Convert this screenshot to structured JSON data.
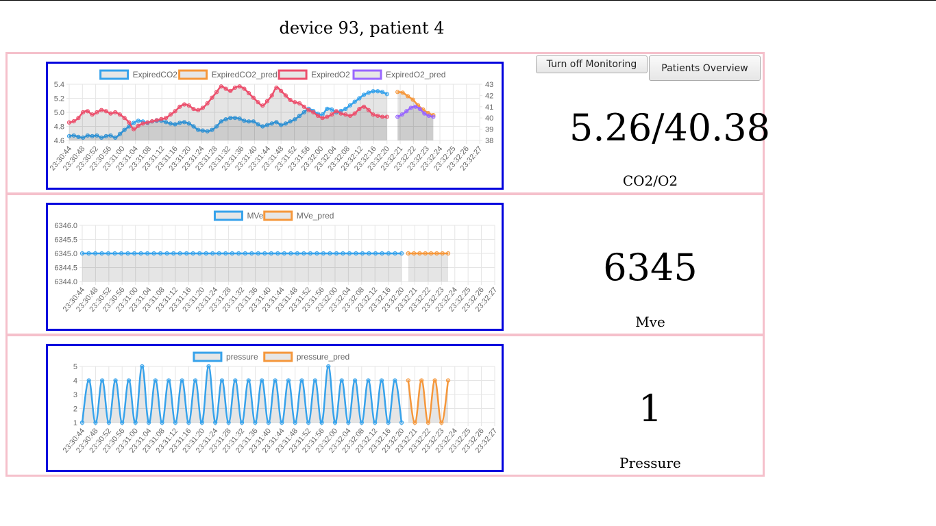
{
  "page": {
    "title": "device 93, patient 4"
  },
  "buttons": {
    "monitoring": "Turn off Monitoring",
    "overview": "Patients Overview"
  },
  "panels": [
    {
      "value": "5.26/40.38",
      "label": "CO2/O2"
    },
    {
      "value": "6345",
      "label": "Mve"
    },
    {
      "value": "1",
      "label": "Pressure"
    }
  ],
  "colors": {
    "blue": "#36a2eb",
    "orange": "#f5973b",
    "red": "#ec4f6c",
    "purple": "#9966ff",
    "panel_border": "#f5c0cb",
    "chart_border": "#0000dd"
  },
  "chart_data": [
    {
      "type": "line",
      "categories": [
        "23:30:44",
        "23:30:48",
        "23:30:52",
        "23:30:56",
        "23:31:00",
        "23:31:04",
        "23:31:08",
        "23:31:12",
        "23:31:16",
        "23:31:20",
        "23:31:24",
        "23:31:28",
        "23:31:32",
        "23:31:36",
        "23:31:40",
        "23:31:44",
        "23:31:48",
        "23:31:52",
        "23:31:56",
        "23:32:00",
        "23:32:04",
        "23:32:08",
        "23:32:12",
        "23:32:16",
        "23:32:20",
        "23:32:21",
        "23:32:22",
        "23:32:23",
        "23:32:24",
        "23:32:25",
        "23:32:26",
        "23:32:27"
      ],
      "y_left": {
        "ticks": [
          "4.6",
          "4.8",
          "5.0",
          "5.2",
          "5.4"
        ],
        "range": [
          4.6,
          5.4
        ]
      },
      "y_right": {
        "ticks": [
          "38",
          "39",
          "40",
          "41",
          "42",
          "43"
        ],
        "range": [
          38,
          43
        ]
      },
      "legend": {
        "position": "top"
      },
      "series": [
        {
          "name": "ExpiredCO2",
          "color": "#36a2eb",
          "axis": "left",
          "range_x": [
            0,
            24
          ],
          "values": [
            4.66,
            4.67,
            4.65,
            4.64,
            4.67,
            4.66,
            4.67,
            4.64,
            4.66,
            4.67,
            4.64,
            4.69,
            4.75,
            4.8,
            4.85,
            4.88,
            4.87,
            4.85,
            4.87,
            4.88,
            4.88,
            4.86,
            4.84,
            4.83,
            4.85,
            4.86,
            4.84,
            4.8,
            4.75,
            4.74,
            4.73,
            4.75,
            4.8,
            4.87,
            4.9,
            4.92,
            4.92,
            4.91,
            4.88,
            4.87,
            4.87,
            4.83,
            4.8,
            4.82,
            4.84,
            4.86,
            4.82,
            4.84,
            4.87,
            4.9,
            4.95,
            5.0,
            5.05,
            5.02,
            4.98,
            4.97,
            5.05,
            5.04,
            5.0,
            5.02,
            5.05,
            5.1,
            5.15,
            5.2,
            5.25,
            5.28,
            5.3,
            5.3,
            5.29,
            5.26
          ]
        },
        {
          "name": "ExpiredCO2_pred",
          "color": "#f5973b",
          "axis": "left",
          "range_x": [
            24.8,
            27.5
          ],
          "values": [
            5.29,
            5.28,
            5.23,
            5.18,
            5.1,
            5.04,
            4.99,
            4.96
          ]
        },
        {
          "name": "ExpiredO2",
          "color": "#ec4f6c",
          "axis": "right",
          "range_x": [
            0,
            24
          ],
          "values": [
            39.6,
            39.7,
            40.0,
            40.5,
            40.6,
            40.3,
            40.5,
            40.7,
            40.6,
            40.4,
            40.5,
            40.3,
            40.0,
            39.6,
            39.0,
            39.3,
            39.5,
            39.6,
            39.7,
            39.8,
            39.9,
            40.0,
            40.3,
            40.6,
            41.0,
            41.2,
            41.1,
            40.8,
            40.7,
            40.9,
            41.3,
            41.8,
            42.3,
            42.8,
            42.6,
            42.4,
            42.7,
            42.8,
            42.6,
            42.2,
            41.8,
            41.4,
            41.1,
            41.5,
            42.0,
            42.7,
            42.4,
            42.0,
            41.6,
            41.4,
            41.3,
            41.0,
            40.7,
            40.5,
            40.2,
            40.0,
            40.1,
            40.3,
            40.6,
            40.4,
            40.3,
            40.2,
            40.4,
            40.8,
            41.0,
            40.7,
            40.3,
            40.2,
            40.1,
            40.1
          ]
        },
        {
          "name": "ExpiredO2_pred",
          "color": "#9966ff",
          "axis": "right",
          "range_x": [
            24.8,
            27.5
          ],
          "values": [
            40.1,
            40.3,
            40.6,
            40.9,
            41.0,
            40.8,
            40.4,
            40.2,
            40.1
          ]
        }
      ]
    },
    {
      "type": "line",
      "categories": [
        "23:30:44",
        "23:30:48",
        "23:30:52",
        "23:30:56",
        "23:31:00",
        "23:31:04",
        "23:31:08",
        "23:31:12",
        "23:31:16",
        "23:31:20",
        "23:31:24",
        "23:31:28",
        "23:31:32",
        "23:31:36",
        "23:31:40",
        "23:31:44",
        "23:31:48",
        "23:31:52",
        "23:31:56",
        "23:32:00",
        "23:32:04",
        "23:32:08",
        "23:32:12",
        "23:32:16",
        "23:32:20",
        "23:32:21",
        "23:32:22",
        "23:32:23",
        "23:32:24",
        "23:32:25",
        "23:32:26",
        "23:32:27"
      ],
      "y_left": {
        "ticks": [
          "6344.0",
          "6344.5",
          "6345.0",
          "6345.5",
          "6346.0"
        ],
        "range": [
          6344,
          6346
        ]
      },
      "legend": {
        "position": "top"
      },
      "series": [
        {
          "name": "MVe",
          "color": "#36a2eb",
          "axis": "left",
          "range_x": [
            0,
            24
          ],
          "values": [
            6345,
            6345,
            6345,
            6345,
            6345,
            6345,
            6345,
            6345,
            6345,
            6345,
            6345,
            6345,
            6345,
            6345,
            6345,
            6345,
            6345,
            6345,
            6345,
            6345,
            6345,
            6345,
            6345,
            6345,
            6345,
            6345,
            6345,
            6345,
            6345,
            6345,
            6345,
            6345,
            6345,
            6345,
            6345,
            6345,
            6345,
            6345,
            6345,
            6345,
            6345,
            6345,
            6345,
            6345,
            6345,
            6345,
            6345,
            6345,
            6345,
            6345
          ]
        },
        {
          "name": "MVe_pred",
          "color": "#f5973b",
          "axis": "left",
          "range_x": [
            24.5,
            27.5
          ],
          "values": [
            6345,
            6345,
            6345,
            6345,
            6345,
            6345,
            6345,
            6345
          ]
        }
      ]
    },
    {
      "type": "line",
      "categories": [
        "23:30:44",
        "23:30:48",
        "23:30:52",
        "23:30:56",
        "23:31:00",
        "23:31:04",
        "23:31:08",
        "23:31:12",
        "23:31:16",
        "23:31:20",
        "23:31:24",
        "23:31:28",
        "23:31:32",
        "23:31:36",
        "23:31:40",
        "23:31:44",
        "23:31:48",
        "23:31:52",
        "23:31:56",
        "23:32:00",
        "23:32:04",
        "23:32:08",
        "23:32:12",
        "23:32:16",
        "23:32:20",
        "23:32:21",
        "23:32:22",
        "23:32:23",
        "23:32:24",
        "23:32:25",
        "23:32:26",
        "23:32:27"
      ],
      "y_left": {
        "ticks": [
          "1",
          "2",
          "3",
          "4",
          "5"
        ],
        "range": [
          1,
          5
        ]
      },
      "legend": {
        "position": "top"
      },
      "series": [
        {
          "name": "pressure",
          "color": "#36a2eb",
          "axis": "left",
          "range_x": [
            0,
            24
          ],
          "values": [
            1,
            4,
            1,
            4,
            1,
            4,
            1,
            4,
            1,
            5,
            1,
            4,
            1,
            4,
            1,
            4,
            1,
            4,
            1,
            5,
            1,
            4,
            1,
            4,
            1,
            4,
            1,
            4,
            1,
            4,
            1,
            4,
            1,
            4,
            1,
            4,
            1,
            5,
            1,
            4,
            1,
            4,
            1,
            4,
            1,
            4,
            1,
            4,
            1
          ]
        },
        {
          "name": "pressure_pred",
          "color": "#f5973b",
          "axis": "left",
          "range_x": [
            24.5,
            27.5
          ],
          "values": [
            4,
            1,
            4,
            1,
            4,
            1,
            4
          ]
        }
      ]
    }
  ]
}
